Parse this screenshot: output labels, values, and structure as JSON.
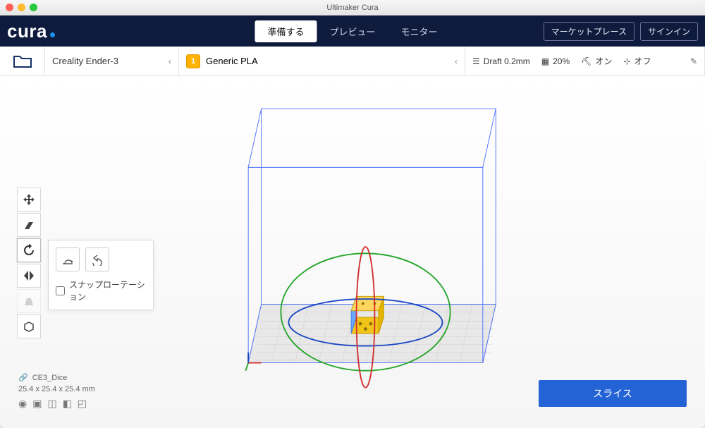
{
  "window": {
    "title": "Ultimaker Cura"
  },
  "logo": "cura",
  "tabs": {
    "prepare": "準備する",
    "preview": "プレビュー",
    "monitor": "モニター"
  },
  "topbar": {
    "marketplace": "マーケットプレース",
    "signin": "サインイン"
  },
  "stagebar": {
    "printer": "Creality Ender-3",
    "material": "Generic PLA",
    "settings": {
      "profile": "Draft 0.2mm",
      "infill": "20%",
      "support": "オン",
      "adhesion": "オフ"
    }
  },
  "rotate_panel": {
    "snap_label": "スナップローテーション"
  },
  "footer": {
    "object_name": "CE3_Dice",
    "dimensions": "25.4 x 25.4 x 25.4 mm"
  },
  "slice_button": "スライス",
  "colors": {
    "accent": "#2463d6",
    "topbar": "#0f1b3d",
    "warn": "#ffb300"
  }
}
